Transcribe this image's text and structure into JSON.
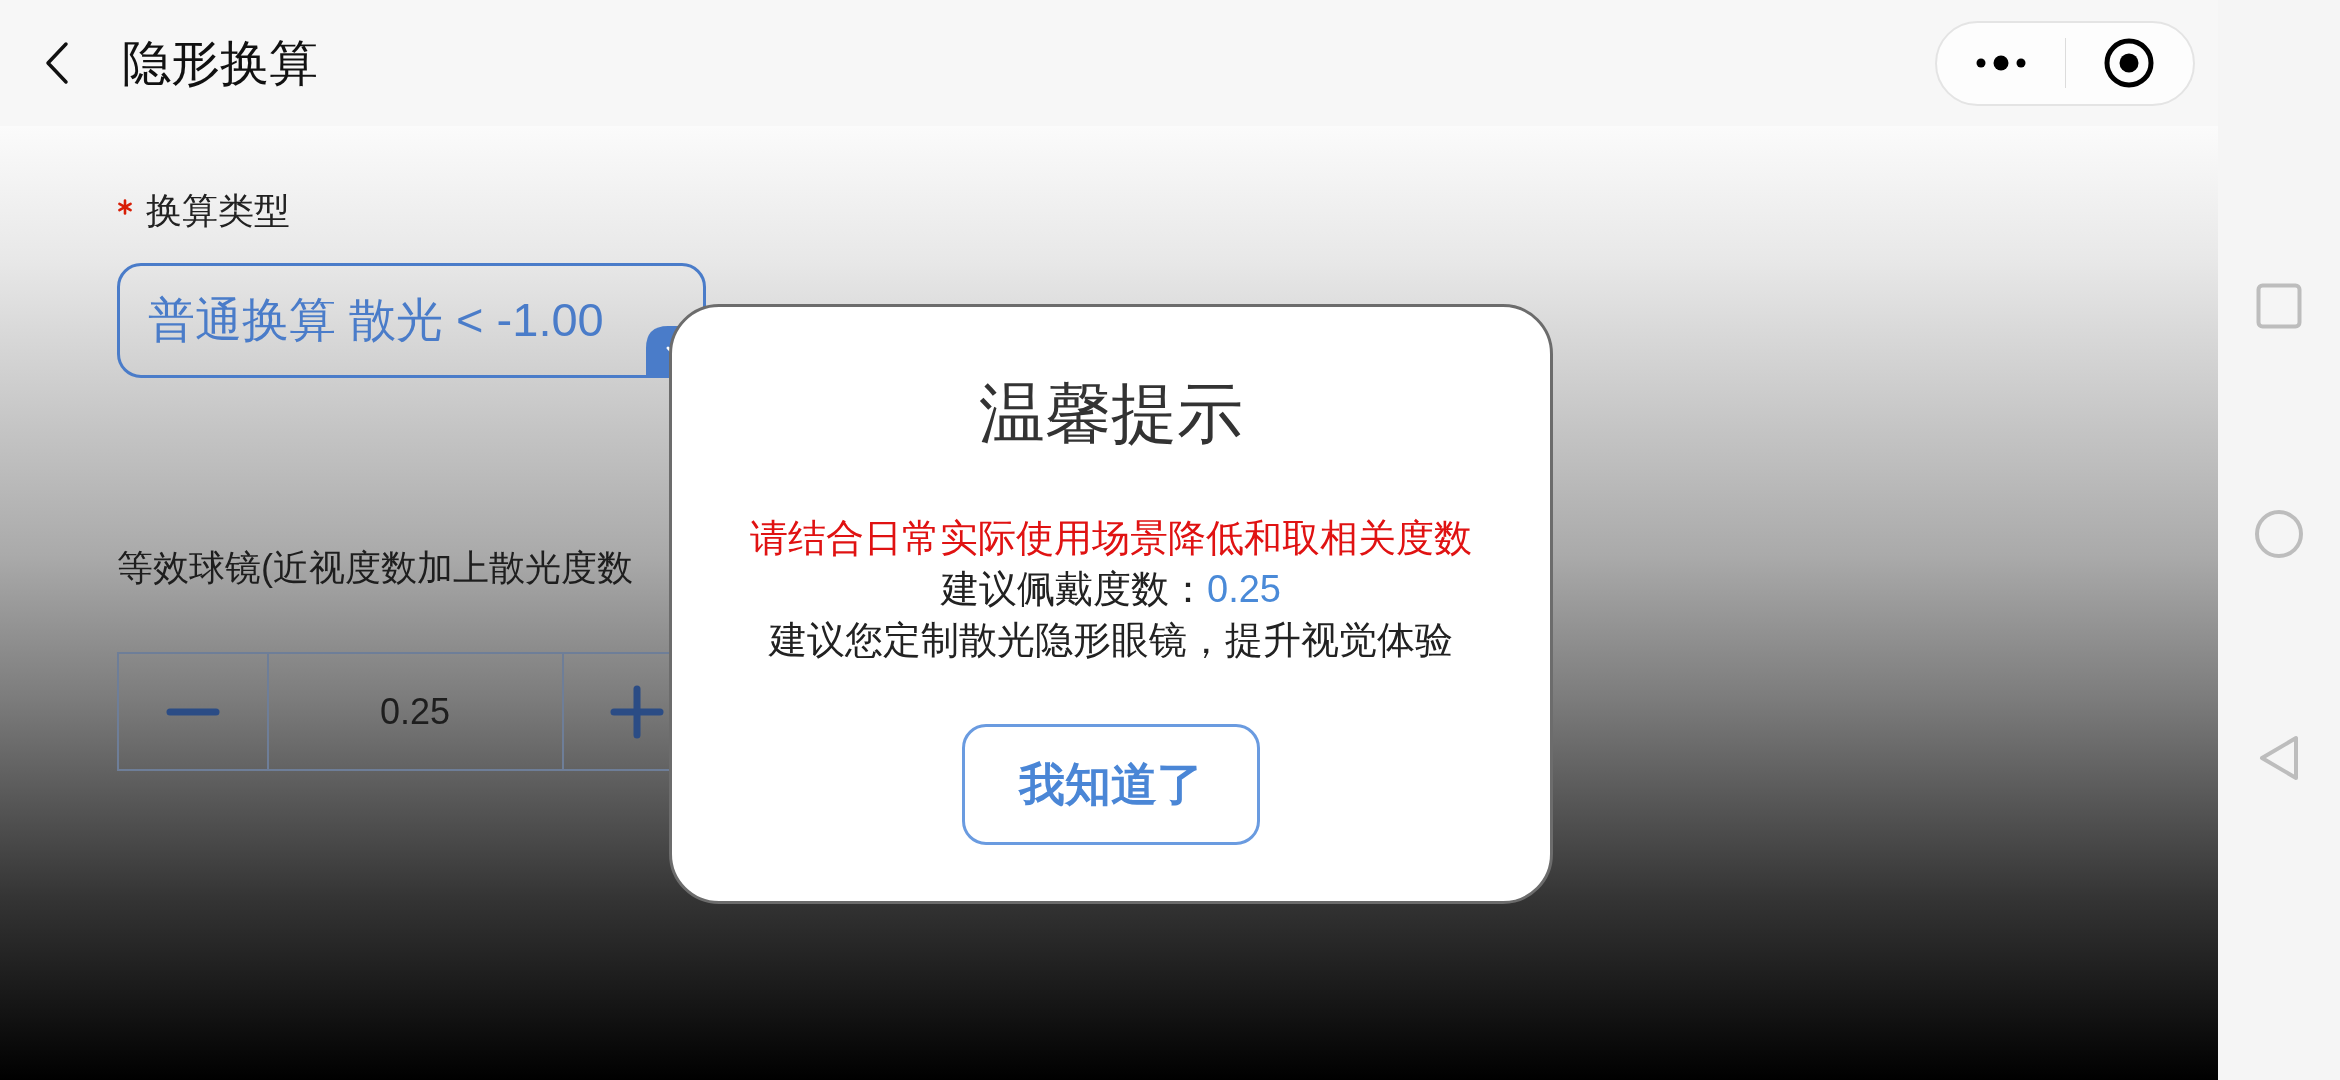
{
  "header": {
    "title": "隐形换算"
  },
  "form": {
    "type_field": {
      "label": "换算类型",
      "required": true,
      "value": "普通换算 散光 < -1.00"
    },
    "equivalent_label": "等效球镜(近视度数加上散光度数",
    "stepper": {
      "value": "0.25"
    }
  },
  "dialog": {
    "title": "温馨提示",
    "warning": "请结合日常实际使用场景降低和取相关度数",
    "suggestion": {
      "label": "建议佩戴度数：",
      "value": "0.25"
    },
    "note": "建议您定制散光隐形眼镜，提升视觉体验",
    "button": "我知道了"
  }
}
